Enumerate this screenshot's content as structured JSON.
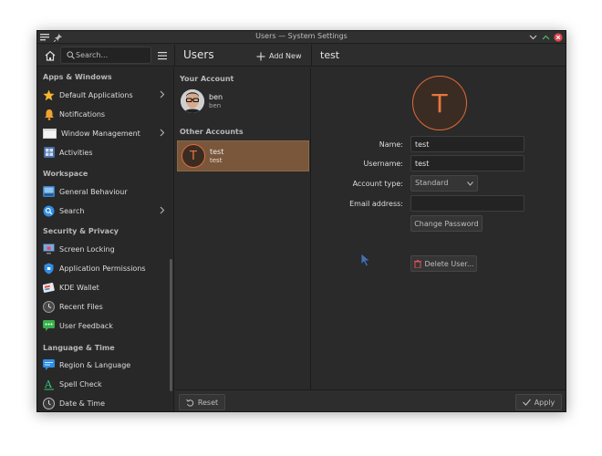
{
  "window": {
    "title": "Users — System Settings",
    "accent": "#7a573a",
    "avatar_accent": "#e06a3a"
  },
  "header": {
    "search_placeholder": "Search...",
    "page_title": "Users",
    "add_new_label": "Add New",
    "detail_title": "test"
  },
  "sidebar": {
    "sections": [
      {
        "title": "Apps & Windows"
      },
      {
        "title": "Workspace"
      },
      {
        "title": "Security & Privacy"
      },
      {
        "title": "Language & Time"
      }
    ],
    "items": [
      {
        "label": "Default Applications",
        "icon": "star-icon",
        "has_children": true
      },
      {
        "label": "Notifications",
        "icon": "bell-icon",
        "has_children": false
      },
      {
        "label": "Window Management",
        "icon": "window-icon",
        "has_children": true
      },
      {
        "label": "Activities",
        "icon": "activities-icon",
        "has_children": false
      },
      {
        "label": "General Behaviour",
        "icon": "general-behaviour-icon",
        "has_children": false
      },
      {
        "label": "Search",
        "icon": "search-icon",
        "has_children": true
      },
      {
        "label": "Screen Locking",
        "icon": "screen-lock-icon",
        "has_children": false
      },
      {
        "label": "Application Permissions",
        "icon": "shield-icon",
        "has_children": false
      },
      {
        "label": "KDE Wallet",
        "icon": "wallet-icon",
        "has_children": false
      },
      {
        "label": "Recent Files",
        "icon": "clock-icon",
        "has_children": false
      },
      {
        "label": "User Feedback",
        "icon": "feedback-icon",
        "has_children": false
      },
      {
        "label": "Region & Language",
        "icon": "region-icon",
        "has_children": false
      },
      {
        "label": "Spell Check",
        "icon": "spell-check-icon",
        "has_children": false
      },
      {
        "label": "Date & Time",
        "icon": "date-time-icon",
        "has_children": false
      }
    ]
  },
  "users": {
    "your_account_heading": "Your Account",
    "other_accounts_heading": "Other Accounts",
    "current": {
      "name": "ben",
      "username": "ben"
    },
    "others": [
      {
        "name": "test",
        "username": "test",
        "initial": "T",
        "selected": true
      }
    ]
  },
  "details": {
    "avatar_initial": "T",
    "name_label": "Name:",
    "name_value": "test",
    "username_label": "Username:",
    "username_value": "test",
    "account_type_label": "Account type:",
    "account_type_value": "Standard",
    "email_label": "Email address:",
    "email_value": "",
    "change_password_label": "Change Password",
    "delete_user_label": "Delete User..."
  },
  "footer": {
    "reset_label": "Reset",
    "apply_label": "Apply"
  }
}
